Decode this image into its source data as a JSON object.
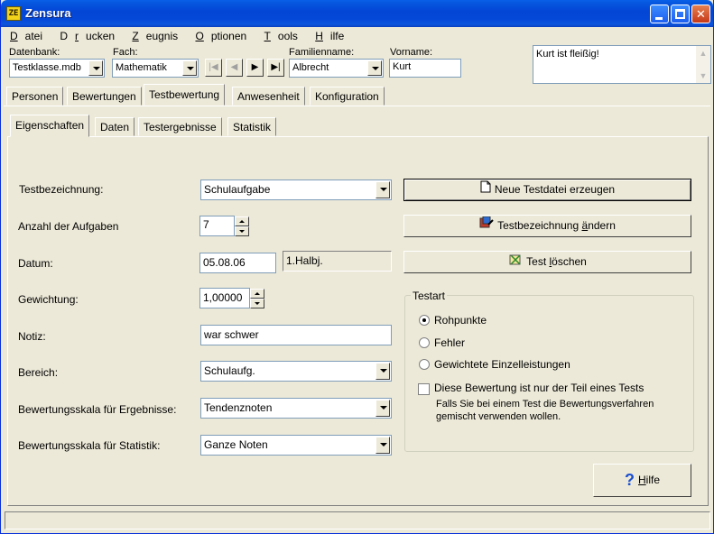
{
  "window": {
    "title": "Zensura",
    "icon_text": "ZE"
  },
  "menu": [
    {
      "label": "Datei",
      "accel": "D",
      "rest": "atei"
    },
    {
      "label": "Drucken",
      "accel": "r",
      "pre": "D",
      "rest": "ucken"
    },
    {
      "label": "Zeugnis",
      "accel": "Z",
      "rest": "eugnis"
    },
    {
      "label": "Optionen",
      "accel": "O",
      "rest": "ptionen"
    },
    {
      "label": "Tools",
      "accel": "T",
      "rest": "ools"
    },
    {
      "label": "Hilfe",
      "accel": "H",
      "rest": "ilfe"
    }
  ],
  "toolbar": {
    "db_label": "Datenbank:",
    "db_value": "Testklasse.mdb",
    "subject_label": "Fach:",
    "subject_value": "Mathematik",
    "lastname_label": "Familienname:",
    "lastname_value": "Albrecht",
    "firstname_label": "Vorname:",
    "firstname_value": "Kurt",
    "nav": [
      "|◀",
      "◀",
      "▶",
      "▶|"
    ],
    "memo": "Kurt ist fleißig!"
  },
  "main_tabs": [
    "Personen",
    "Bewertungen",
    "Testbewertung",
    "Anwesenheit",
    "Konfiguration"
  ],
  "main_tab_active": "Testbewertung",
  "sub_tabs": [
    "Eigenschaften",
    "Daten",
    "Testergebnisse",
    "Statistik"
  ],
  "sub_tab_active": "Eigenschaften",
  "form": {
    "test_name_label": "Testbezeichnung:",
    "test_name_value": "Schulaufgabe",
    "tasks_label": "Anzahl der Aufgaben",
    "tasks_value": "7",
    "date_label": "Datum:",
    "date_value": "05.08.06",
    "semester_value": "1.Halbj.",
    "weight_label": "Gewichtung:",
    "weight_value": "1,00000",
    "note_label": "Notiz:",
    "note_value": "war schwer",
    "area_label": "Bereich:",
    "area_value": "Schulaufg.",
    "scale_results_label": "Bewertungsskala für Ergebnisse:",
    "scale_results_value": "Tendenznoten",
    "scale_stats_label": "Bewertungsskala für Statistik:",
    "scale_stats_value": "Ganze Noten"
  },
  "buttons": {
    "new_file": "Neue Testdatei erzeugen",
    "rename_pre": "Testbezeichnung ",
    "rename_accel": "ä",
    "rename_post": "ndern",
    "delete_pre": "Test ",
    "delete_accel": "l",
    "delete_post": "öschen",
    "help_accel": "H",
    "help_post": "ilfe"
  },
  "testart": {
    "title": "Testart",
    "options": [
      "Rohpunkte",
      "Fehler",
      "Gewichtete Einzelleistungen"
    ],
    "selected": 0,
    "partial_label": "Diese Bewertung ist nur der Teil eines Tests",
    "partial_note": "Falls Sie bei einem Test die Bewertungsverfahren gemischt verwenden wollen.",
    "partial_checked": false
  },
  "colors": {
    "title_bar": "#0346d6",
    "face": "#ece9d8",
    "border": "#7f9db9"
  }
}
